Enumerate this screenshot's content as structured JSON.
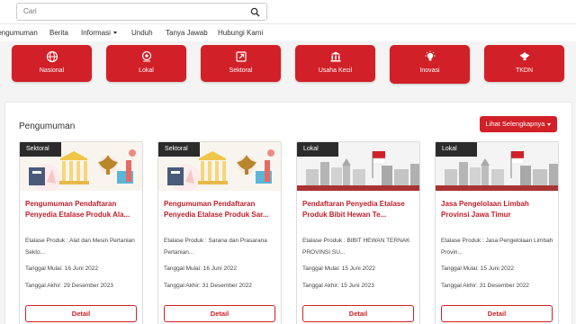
{
  "search": {
    "placeholder": "Cari",
    "icon": "search-icon"
  },
  "nav": {
    "items": [
      "Pengumuman",
      "Berita",
      "Informasi",
      "Unduh",
      "Tanya Jawab",
      "Hubungi Kami"
    ]
  },
  "categories": [
    {
      "label": "Nasional",
      "icon": "globe-icon"
    },
    {
      "label": "Lokal",
      "icon": "map-pin-icon"
    },
    {
      "label": "Sektoral",
      "icon": "external-link-icon"
    },
    {
      "label": "Usaha Kecil",
      "icon": "bank-icon"
    },
    {
      "label": "Inovasi",
      "icon": "lightbulb-icon"
    },
    {
      "label": "TKDN",
      "icon": "indonesia-emblem-icon"
    }
  ],
  "announcements": {
    "title": "Pengumuman",
    "more_label": "Lihat Selengkapnya",
    "detail_label": "Detail",
    "cards": [
      {
        "tag": "Sektoral",
        "title": "Pengumuman Pendaftaran Penyedia Etalase Produk Ala...",
        "desc": "Etalase Produk : Alat dan Mesin Pertanian Sekto...",
        "start": "Tanggal Mulai: 16 Juni 2022",
        "end": "Tanggal Akhir: 29 Desember 2023"
      },
      {
        "tag": "Sektoral",
        "title": "Pengumuman Pendaftaran Penyedia Etalase Produk Sar...",
        "desc": "Etalase Produk : Sarana dan Prasarana Pertanian...",
        "start": "Tanggal Mulai: 16 Juni 2022",
        "end": "Tanggal Akhir: 31 Desember 2022"
      },
      {
        "tag": "Lokal",
        "title": "Pendaftaran Penyedia Etalase Produk Bibit Hewan Te...",
        "desc": "Etalase Produk : BIBIT HEWAN TERNAK PROVINSI SU...",
        "start": "Tanggal Mulai: 15 Juni 2022",
        "end": "Tanggal Akhir: 15 Juni 2023"
      },
      {
        "tag": "Lokal",
        "title": "Jasa Pengelolaan Limbah Provinsi Jawa Timur",
        "desc": "Etalase Produk : Jasa Pengelolaan Limbah Provin...",
        "start": "Tanggal Mulai: 15 Juni 2022",
        "end": "Tanggal Akhir: 31 Desember 2022"
      }
    ]
  },
  "colors": {
    "brand_red": "#d12027",
    "tag_dark": "#2b2b2b"
  }
}
